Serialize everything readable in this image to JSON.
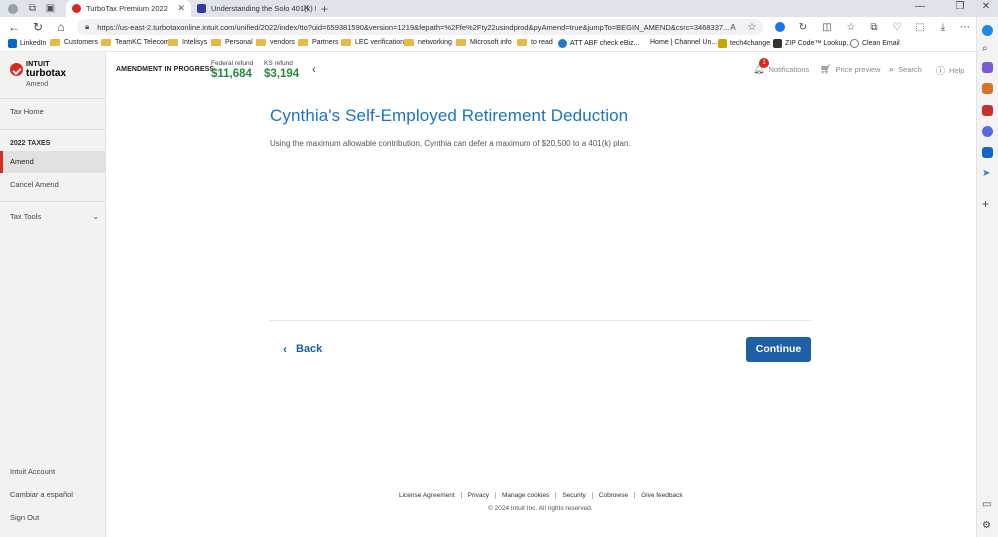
{
  "browser": {
    "tabs": [
      {
        "title": "TurboTax Premium 2022",
        "active": true
      },
      {
        "title": "Understanding the Solo 401(k) E",
        "active": false
      }
    ],
    "url": "https://us-east-2.turbotaxonline.intuit.com/unified/2022/index/tto?uid=659381590&version=1219&fepath=%2Ffe%2Fty22usindprod&pyAmend=true&jumpTo=BEGIN_AMEND&csrc=3468337...",
    "bookmarks": [
      "LinkedIn",
      "Customers",
      "TeamKC Telecom",
      "Intelisys",
      "Personal",
      "vendors",
      "Partners",
      "LEC verification",
      "networking",
      "Microsoft info",
      "to read",
      "ATT ABF check eBiz...",
      "Home | Channel Un...",
      "tech4change",
      "ZIP Code™ Lookup...",
      "Clean Email"
    ]
  },
  "sidebar": {
    "logo_intuit": "INTUIT",
    "logo_turbotax": "turbotax",
    "logo_sub": "Amend",
    "tax_home": "Tax Home",
    "section_2022": "2022 TAXES",
    "amend": "Amend",
    "cancel_amend": "Cancel Amend",
    "tax_tools": "Tax Tools",
    "intuit_account": "Intuit Account",
    "cambiar": "Cambiar a español",
    "sign_out": "Sign Out"
  },
  "topbar": {
    "status": "AMENDMENT IN PROGRESS",
    "federal_label": "Federal refund",
    "federal_value": "$11,684",
    "state_label": "KS refund",
    "state_value": "$3,194",
    "notifications": "Notifications",
    "notif_count": "1",
    "price_preview": "Price preview",
    "search": "Search",
    "help": "Help"
  },
  "main": {
    "title": "Cynthia's Self-Employed Retirement Deduction",
    "body": "Using the maximum allowable contribution, Cynthia can defer a maximum of $20,500 to a 401(k) plan.",
    "back": "Back",
    "continue": "Continue"
  },
  "footer": {
    "links": [
      "License Agreement",
      "Privacy",
      "Manage cookies",
      "Security",
      "Cobrowse",
      "Give feedback"
    ],
    "copyright": "© 2024 Intuit Inc. All rights reserved."
  }
}
